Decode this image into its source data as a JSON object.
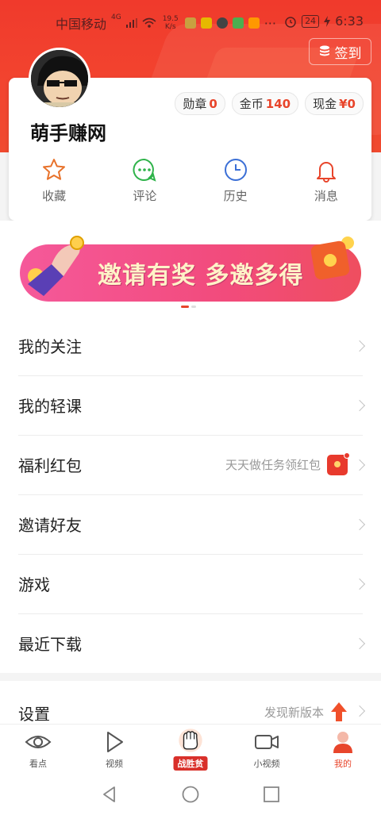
{
  "status_bar": {
    "carrier": "中国移动",
    "network": "4G",
    "speed_value": "19.5",
    "speed_unit": "K/s",
    "battery": "24",
    "time": "6:33"
  },
  "header": {
    "signin_label": "签到"
  },
  "profile": {
    "username": "萌手赚网",
    "stats": [
      {
        "label": "勋章",
        "value": "0"
      },
      {
        "label": "金币",
        "value": "140"
      },
      {
        "label": "现金",
        "value": "¥0"
      }
    ],
    "actions": [
      {
        "label": "收藏",
        "icon": "star-icon"
      },
      {
        "label": "评论",
        "icon": "comment-icon"
      },
      {
        "label": "历史",
        "icon": "clock-icon"
      },
      {
        "label": "消息",
        "icon": "bell-icon"
      }
    ]
  },
  "banner": {
    "text": "邀请有奖 多邀多得"
  },
  "menu": [
    {
      "title": "我的关注",
      "extra": ""
    },
    {
      "title": "我的轻课",
      "extra": ""
    },
    {
      "title": "福利红包",
      "extra": "天天做任务领红包"
    },
    {
      "title": "邀请好友",
      "extra": ""
    },
    {
      "title": "游戏",
      "extra": ""
    },
    {
      "title": "最近下载",
      "extra": ""
    }
  ],
  "settings": {
    "title": "设置",
    "extra": "发现新版本"
  },
  "tabs": [
    {
      "label": "看点",
      "icon": "eye-icon"
    },
    {
      "label": "视频",
      "icon": "play-icon"
    },
    {
      "label": "战胜贫",
      "icon": "fist-icon"
    },
    {
      "label": "小视频",
      "icon": "camera-icon"
    },
    {
      "label": "我的",
      "icon": "profile-icon"
    }
  ],
  "colors": {
    "brand_red": "#e8452b",
    "hero": "#f03a2c"
  }
}
